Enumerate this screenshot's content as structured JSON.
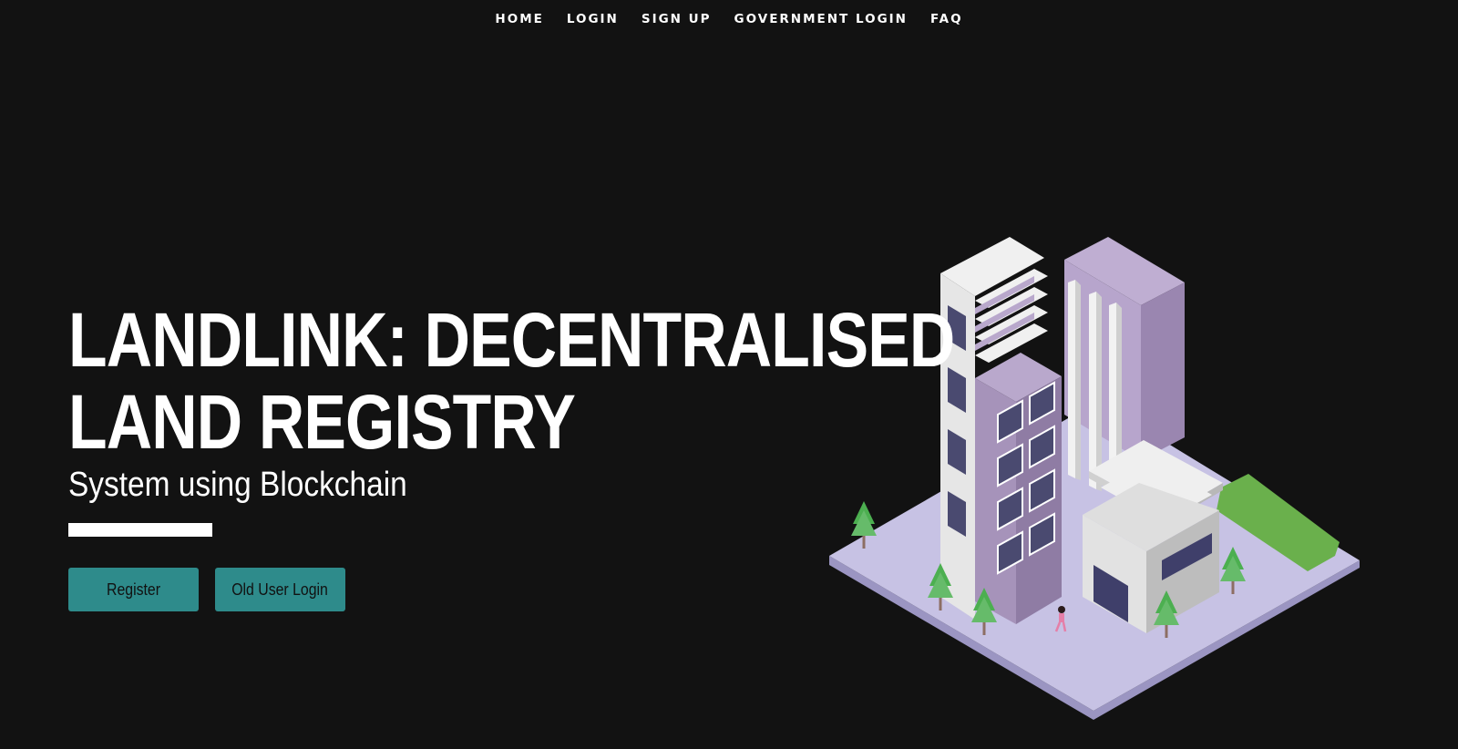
{
  "nav": {
    "items": [
      {
        "label": "HOME"
      },
      {
        "label": "LOGIN"
      },
      {
        "label": "SIGN UP"
      },
      {
        "label": "GOVERNMENT LOGIN"
      },
      {
        "label": "FAQ"
      }
    ]
  },
  "hero": {
    "title_line1": "LANDLINK: DECENTRALISED",
    "title_line2": "LAND REGISTRY",
    "subtitle": "System using Blockchain",
    "buttons": {
      "register": "Register",
      "old_user_login": "Old User Login"
    }
  },
  "colors": {
    "background": "#121212",
    "button": "#2e8b8b",
    "text": "#ffffff",
    "platform": "#c5c0e0",
    "building_purple": "#a593b8",
    "building_white": "#e8e8e8",
    "grass": "#6ab04c"
  }
}
